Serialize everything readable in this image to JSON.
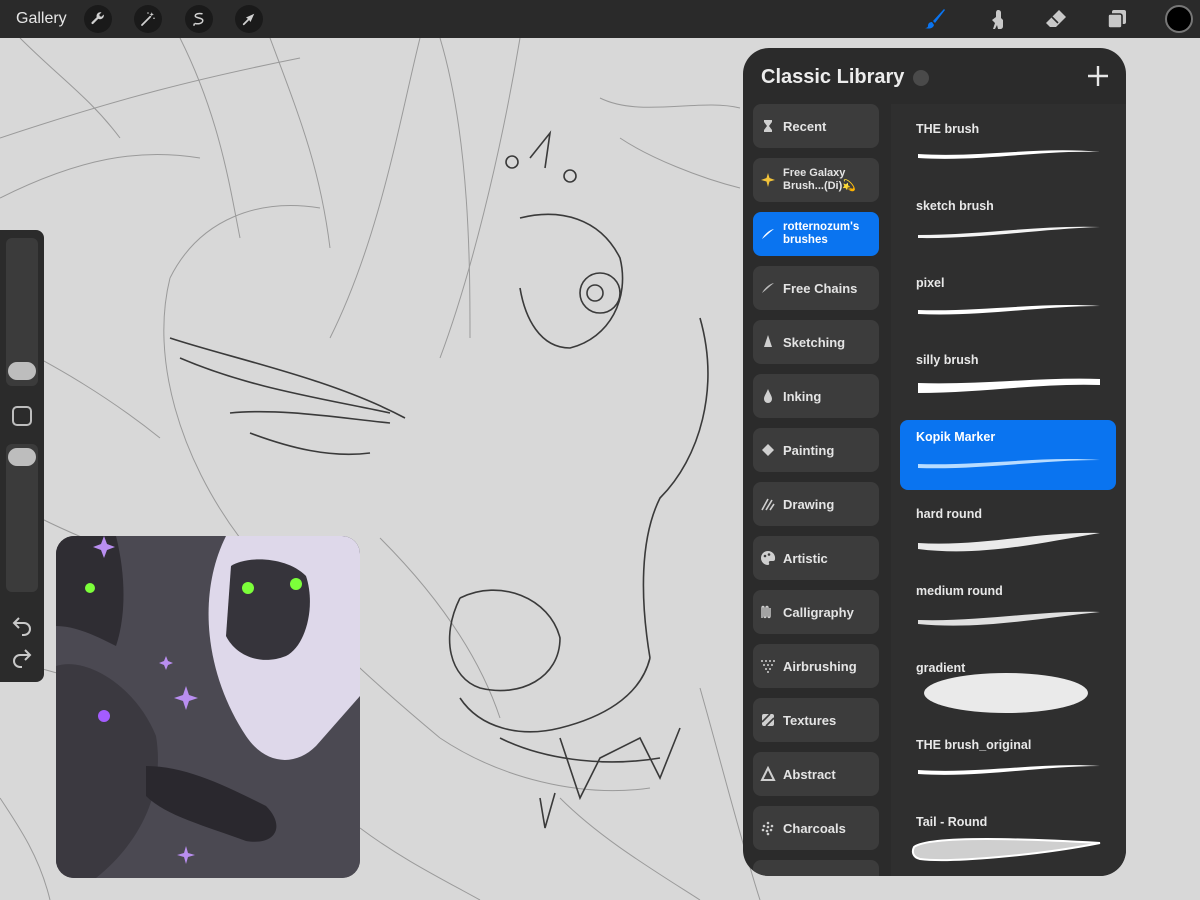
{
  "topbar": {
    "gallery_label": "Gallery",
    "left_tools": [
      "wrench-icon",
      "magic-wand-icon",
      "selection-icon",
      "transform-icon"
    ],
    "right_tools": [
      "brush-icon",
      "smudge-icon",
      "eraser-icon",
      "layers-icon"
    ],
    "active_tool": "brush-icon",
    "accent": "#0a74f0",
    "current_color": "#000000"
  },
  "sidebar": {
    "icons": [
      "undo-icon",
      "redo-icon"
    ]
  },
  "library": {
    "title": "Classic Library",
    "brush_sets": [
      {
        "label": "Recent",
        "icon": "hourglass-icon"
      },
      {
        "label": "Free Galaxy Brush...(Di)💫",
        "icon": "galaxy-icon"
      },
      {
        "label": "rotternozum's brushes",
        "icon": "stroke-icon",
        "active": true
      },
      {
        "label": "Free Chains",
        "icon": "stroke-icon"
      },
      {
        "label": "Sketching",
        "icon": "pencil-tip-icon"
      },
      {
        "label": "Inking",
        "icon": "ink-drop-icon"
      },
      {
        "label": "Painting",
        "icon": "paint-bucket-icon"
      },
      {
        "label": "Drawing",
        "icon": "drawing-icon"
      },
      {
        "label": "Artistic",
        "icon": "palette-icon"
      },
      {
        "label": "Calligraphy",
        "icon": "calligraphy-icon"
      },
      {
        "label": "Airbrushing",
        "icon": "airbrush-icon"
      },
      {
        "label": "Textures",
        "icon": "texture-icon"
      },
      {
        "label": "Abstract",
        "icon": "triangle-icon"
      },
      {
        "label": "Charcoals",
        "icon": "charcoal-icon"
      }
    ],
    "brushes": [
      {
        "name": "THE brush"
      },
      {
        "name": "sketch brush"
      },
      {
        "name": "pixel"
      },
      {
        "name": "silly brush"
      },
      {
        "name": "Kopik Marker",
        "active": true
      },
      {
        "name": "hard round"
      },
      {
        "name": "medium round"
      },
      {
        "name": "gradient"
      },
      {
        "name": "THE brush_original"
      },
      {
        "name": "Tail - Round"
      }
    ]
  }
}
